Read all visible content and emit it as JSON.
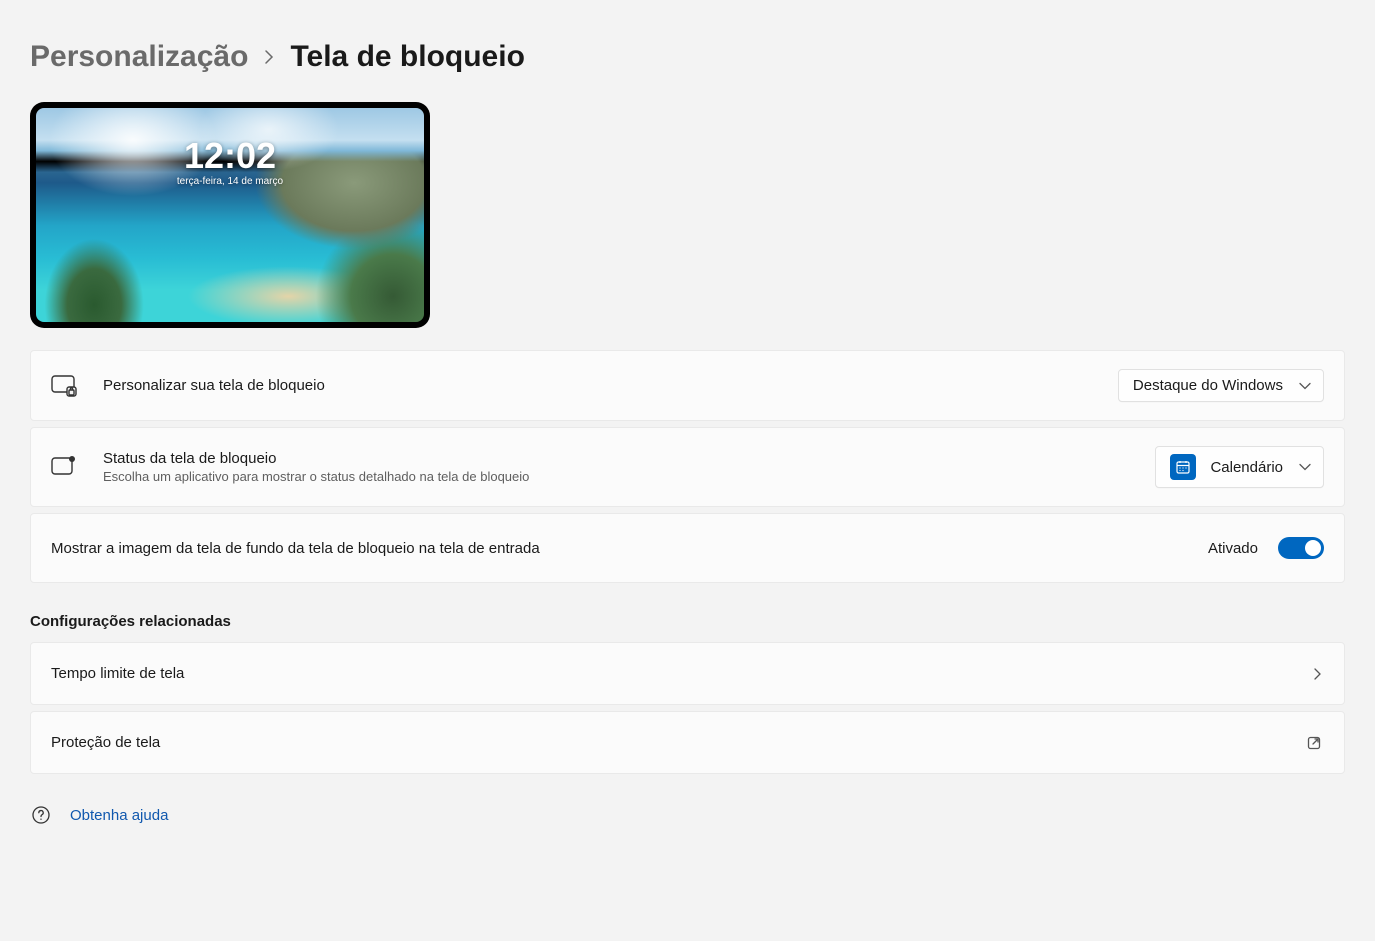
{
  "breadcrumb": {
    "parent": "Personalização",
    "current": "Tela de bloqueio"
  },
  "preview": {
    "time": "12:02",
    "date": "terça-feira, 14 de março"
  },
  "settings": {
    "personalize": {
      "title": "Personalizar sua tela de bloqueio",
      "selected": "Destaque do Windows"
    },
    "status": {
      "title": "Status da tela de bloqueio",
      "subtitle": "Escolha um aplicativo para mostrar o status detalhado na tela de bloqueio",
      "selected": "Calendário"
    },
    "signin_background": {
      "title": "Mostrar a imagem da tela de fundo da tela de bloqueio na tela de entrada",
      "state_label": "Ativado",
      "enabled": true
    }
  },
  "related": {
    "heading": "Configurações relacionadas",
    "items": [
      {
        "label": "Tempo limite de tela",
        "kind": "internal"
      },
      {
        "label": "Proteção de tela",
        "kind": "external"
      }
    ]
  },
  "help": {
    "label": "Obtenha ajuda"
  }
}
